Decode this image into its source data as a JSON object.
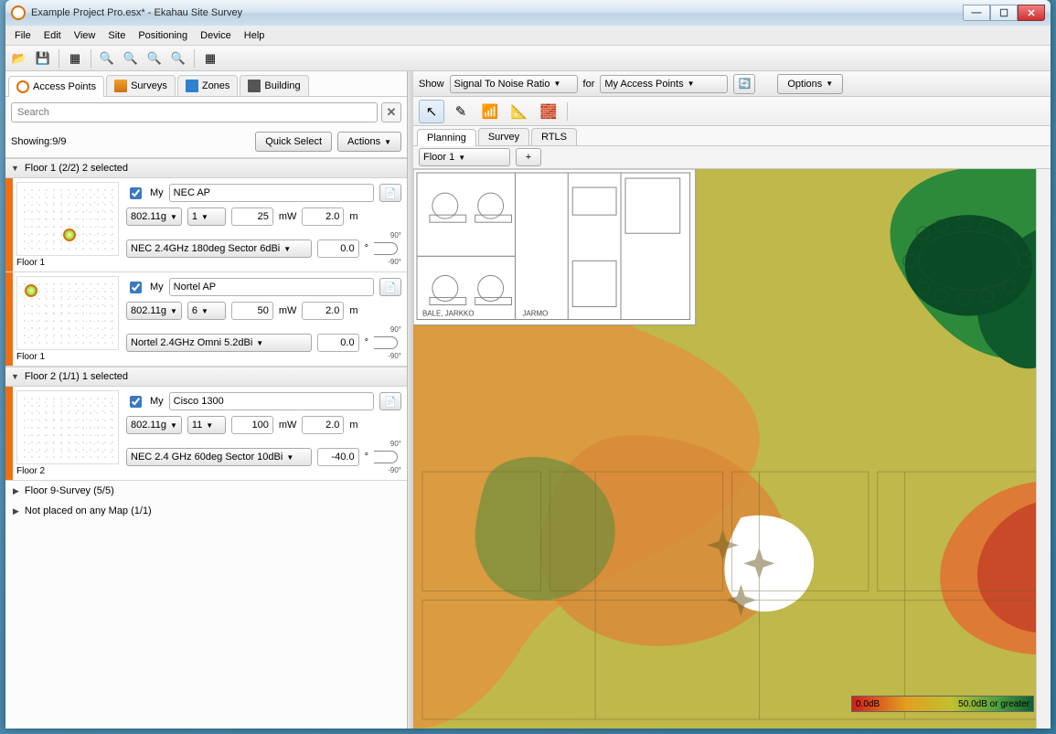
{
  "window": {
    "title": "Example Project Pro.esx* - Ekahau Site Survey"
  },
  "menubar": [
    "File",
    "Edit",
    "View",
    "Site",
    "Positioning",
    "Device",
    "Help"
  ],
  "left": {
    "tabs": [
      {
        "label": "Access Points"
      },
      {
        "label": "Surveys"
      },
      {
        "label": "Zones"
      },
      {
        "label": "Building"
      }
    ],
    "search_placeholder": "Search",
    "showing": "Showing:9/9",
    "quick_select": "Quick Select",
    "actions": "Actions",
    "groups": [
      {
        "label": "Floor 1 (2/2) 2 selected"
      },
      {
        "label": "Floor 2 (1/1) 1 selected"
      }
    ],
    "aps": [
      {
        "floor": "Floor 1",
        "my": "My",
        "name": "NEC AP",
        "band": "802.11g",
        "chan": "1",
        "power": "25",
        "power_unit": "mW",
        "height": "2.0",
        "height_unit": "m",
        "antenna": "NEC 2.4GHz 180deg Sector 6dBi",
        "angle": "0.0"
      },
      {
        "floor": "Floor 1",
        "my": "My",
        "name": "Nortel AP",
        "band": "802.11g",
        "chan": "6",
        "power": "50",
        "power_unit": "mW",
        "height": "2.0",
        "height_unit": "m",
        "antenna": "Nortel 2.4GHz Omni 5.2dBi",
        "angle": "0.0"
      },
      {
        "floor": "Floor 2",
        "my": "My",
        "name": "Cisco 1300",
        "band": "802.11g",
        "chan": "11",
        "power": "100",
        "power_unit": "mW",
        "height": "2.0",
        "height_unit": "m",
        "antenna": "NEC 2.4 GHz 60deg Sector 10dBi",
        "angle": "-40.0"
      }
    ],
    "tree_rows": [
      "Floor 9-Survey (5/5)",
      "Not placed on any Map (1/1)"
    ],
    "angle_top": "90°",
    "angle_bot": "-90°",
    "angle_unit": "°"
  },
  "right": {
    "show_label": "Show",
    "show_sel": "Signal To Noise Ratio",
    "for_label": "for",
    "for_sel": "My Access Points",
    "options": "Options",
    "map_tabs": [
      "Planning",
      "Survey",
      "RTLS"
    ],
    "floor_sel": "Floor 1",
    "room_labels": [
      "BALE, JARKKO",
      "JARMO"
    ],
    "legend_min": "0.0dB",
    "legend_max": "50.0dB or greater"
  }
}
